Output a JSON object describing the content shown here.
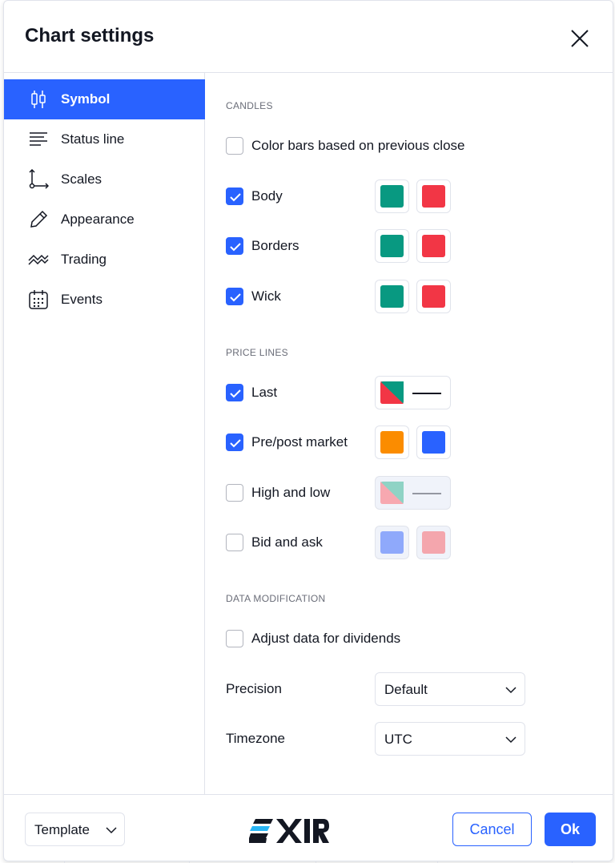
{
  "dialog": {
    "title": "Chart settings"
  },
  "sidebar": {
    "items": [
      {
        "label": "Symbol",
        "icon": "candles-icon",
        "active": true
      },
      {
        "label": "Status line",
        "icon": "status-lines-icon",
        "active": false
      },
      {
        "label": "Scales",
        "icon": "scales-icon",
        "active": false
      },
      {
        "label": "Appearance",
        "icon": "pencil-icon",
        "active": false
      },
      {
        "label": "Trading",
        "icon": "trading-icon",
        "active": false
      },
      {
        "label": "Events",
        "icon": "calendar-icon",
        "active": false
      }
    ]
  },
  "candles": {
    "section_title": "CANDLES",
    "color_bars": {
      "label": "Color bars based on previous close",
      "checked": false
    },
    "body": {
      "label": "Body",
      "checked": true,
      "up_color": "#089981",
      "down_color": "#f23645"
    },
    "borders": {
      "label": "Borders",
      "checked": true,
      "up_color": "#089981",
      "down_color": "#f23645"
    },
    "wick": {
      "label": "Wick",
      "checked": true,
      "up_color": "#089981",
      "down_color": "#f23645"
    }
  },
  "price_lines": {
    "section_title": "PRICE LINES",
    "last": {
      "label": "Last",
      "checked": true,
      "color_a": "#f23645",
      "color_b": "#089981",
      "line_color": "#131722"
    },
    "pre_post": {
      "label": "Pre/post market",
      "checked": true,
      "color_a": "#fb8c00",
      "color_b": "#2962ff"
    },
    "high_low": {
      "label": "High and low",
      "checked": false,
      "color_a": "#f7a8b0",
      "color_b": "#8fd3c5",
      "line_color": "#9598a1"
    },
    "bid_ask": {
      "label": "Bid and ask",
      "checked": false,
      "color_a": "#8fa9fb",
      "color_b": "#f4a6ad"
    }
  },
  "data_modification": {
    "section_title": "DATA MODIFICATION",
    "adjust_dividends": {
      "label": "Adjust data for dividends",
      "checked": false
    },
    "precision": {
      "label": "Precision",
      "value": "Default"
    },
    "timezone": {
      "label": "Timezone",
      "value": "UTC"
    }
  },
  "footer": {
    "template_label": "Template",
    "logo_text": "EXIR",
    "cancel_label": "Cancel",
    "ok_label": "Ok"
  },
  "colors": {
    "accent": "#2962ff",
    "border": "#e0e3eb",
    "text": "#131722",
    "muted": "#6a6d78"
  }
}
